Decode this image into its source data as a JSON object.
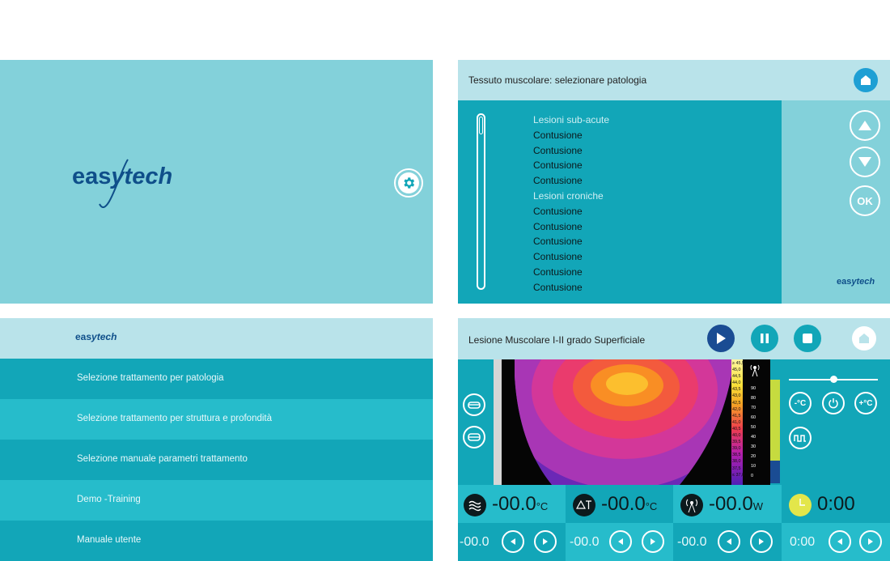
{
  "splash": {
    "logo_part1": "eas",
    "logo_y": "y",
    "logo_part2": "tech"
  },
  "pathology": {
    "title": "Tessuto muscolare: selezionare patologia",
    "items": [
      {
        "text": "Lesioni sub-acute",
        "kind": "hdr"
      },
      {
        "text": "Contusione",
        "kind": "it"
      },
      {
        "text": "Contusione",
        "kind": "it"
      },
      {
        "text": "Contusione",
        "kind": "it"
      },
      {
        "text": "Contusione",
        "kind": "it"
      },
      {
        "text": "Lesioni croniche",
        "kind": "hdr"
      },
      {
        "text": "Contusione",
        "kind": "it"
      },
      {
        "text": "Contusione",
        "kind": "it"
      },
      {
        "text": "Contusione",
        "kind": "it"
      },
      {
        "text": "Contusione",
        "kind": "it"
      },
      {
        "text": "Contusione",
        "kind": "it"
      },
      {
        "text": "Contusione",
        "kind": "it"
      }
    ],
    "ok_label": "OK"
  },
  "menu": {
    "items": [
      "Selezione trattamento per patologia",
      "Selezione trattamento per struttura e profondità",
      "Selezione manuale parametri trattamento",
      "Demo -Training",
      "Manuale utente"
    ]
  },
  "treatment": {
    "title": "Lesione Muscolare I-II grado Superficiale",
    "minus_temp_label": "-°C",
    "plus_temp_label": "+°C",
    "temp_scale": [
      "≥ 45,5",
      "45,0",
      "44,5",
      "44,0",
      "43,5",
      "43,0",
      "42,5",
      "42,0",
      "41,5",
      "41,0",
      "40,5",
      "40,0",
      "39,5",
      "39,0",
      "38,5",
      "38,0",
      "37,5",
      "≤ 37,0"
    ],
    "power_scale": [
      "90",
      "80",
      "70",
      "60",
      "50",
      "40",
      "30",
      "20",
      "10",
      "0"
    ],
    "readouts": [
      {
        "value": "-00.0",
        "unit": "°C",
        "small": "-00.0"
      },
      {
        "value": "-00.0",
        "unit": "°C",
        "small": "-00.0"
      },
      {
        "value": "-00.0",
        "unit": "W",
        "small": "-00.0"
      },
      {
        "value": "0:00",
        "unit": "",
        "small": "0:00"
      }
    ],
    "colors": {
      "teal_dark": "#12a6b8",
      "teal_light": "#83d1da",
      "header": "#b9e3ea",
      "accent_yellow": "#e3e64a",
      "navy": "#1a4c93"
    }
  }
}
